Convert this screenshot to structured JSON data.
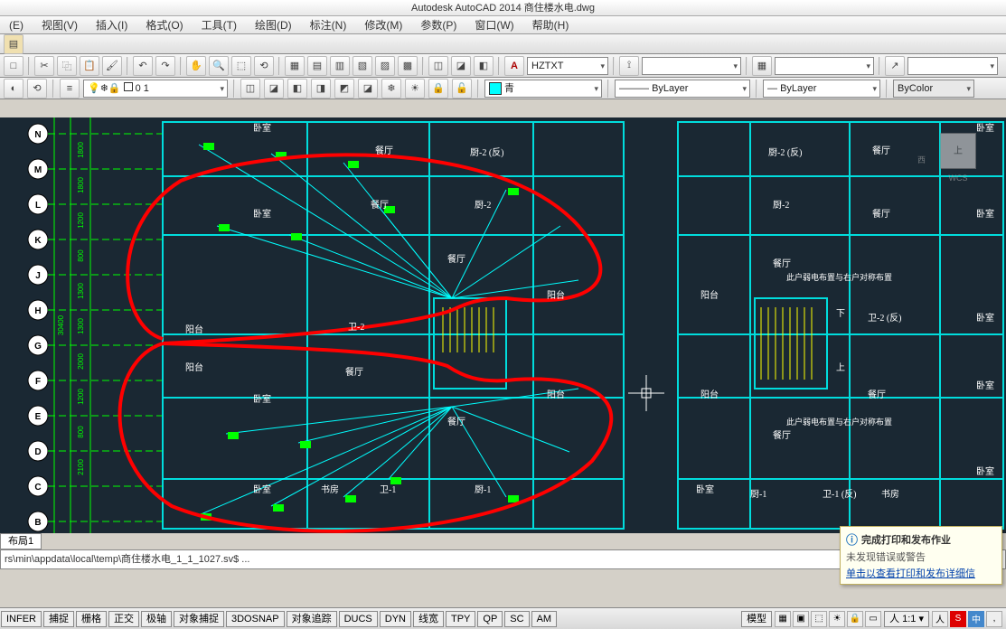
{
  "title": "Autodesk AutoCAD 2014     商住楼水电.dwg",
  "menus": [
    "(E)",
    "视图(V)",
    "插入(I)",
    "格式(O)",
    "工具(T)",
    "绘图(D)",
    "标注(N)",
    "修改(M)",
    "参数(P)",
    "窗口(W)",
    "帮助(H)"
  ],
  "textstyle": "HZTXT",
  "layer_current": "0 1",
  "color_current": "青",
  "linetype": "ByLayer",
  "lineweight": "ByLayer",
  "plotstyle": "ByColor",
  "model_tab": "布局1",
  "cmdline": "rs\\min\\appdata\\local\\temp\\商住楼水电_1_1_1027.sv$ ...",
  "status_btns": [
    "INFER",
    "捕捉",
    "栅格",
    "正交",
    "极轴",
    "对象捕捉",
    "3DOSNAP",
    "对象追踪",
    "DUCS",
    "DYN",
    "线宽",
    "TPY",
    "QP",
    "SC",
    "AM"
  ],
  "status_right": {
    "model": "模型",
    "scale": "1:1"
  },
  "notify": {
    "title": "完成打印和发布作业",
    "line1": "未发现错误或警告",
    "link": "单击以查看打印和发布详细信"
  },
  "viewcube": {
    "face": "上",
    "wcs": "WCS",
    "dir": "西"
  },
  "grid_letters": [
    "N",
    "M",
    "L",
    "K",
    "J",
    "H",
    "G",
    "F",
    "E",
    "D",
    "C",
    "B"
  ],
  "grid_dims": [
    "1800",
    "1800",
    "1200",
    "800",
    "1300",
    "1300",
    "2000",
    "1200",
    "800",
    "2100"
  ],
  "grid_total": "30400",
  "rooms_left": {
    "卧室1": "卧室",
    "餐厅1": "餐厅",
    "厨2反": "厨-2 (反)",
    "卧室2": "卧室",
    "餐厅2": "餐厅",
    "厨2": "厨-2",
    "餐厅3": "餐厅",
    "阳台1": "阳台",
    "阳台2": "阳台",
    "卫2": "卫-2",
    "阳台3": "阳台",
    "餐厅4": "餐厅",
    "卧室4": "卧室",
    "餐厅5": "餐厅",
    "阳台4": "阳台",
    "卧室5": "卧室",
    "书房": "书房",
    "卫1": "卫-1",
    "厨1": "厨-1"
  },
  "rooms_right": {
    "卧室r1": "卧室",
    "餐厅r1": "餐厅",
    "厨2反r": "厨-2 (反)",
    "卧室r2": "卧室",
    "厨2r": "厨-2",
    "餐厅r2": "餐厅",
    "卧室r3": "卧室",
    "餐厅r3": "餐厅",
    "note": "此户弱电布置与右户对称布置",
    "阳台r1": "阳台",
    "卫2反r": "卫-2 (反)",
    "下": "下",
    "上": "上",
    "卧室r4": "卧室",
    "阳台r2": "阳台",
    "餐厅r4": "餐厅",
    "note2": "此户弱电布置与右户对称布置",
    "餐厅r5": "餐厅",
    "卧室r5": "卧室",
    "卧室r6": "卧室",
    "厨1r": "厨-1",
    "卫1反r": "卫-1 (反)",
    "书房r": "书房"
  }
}
